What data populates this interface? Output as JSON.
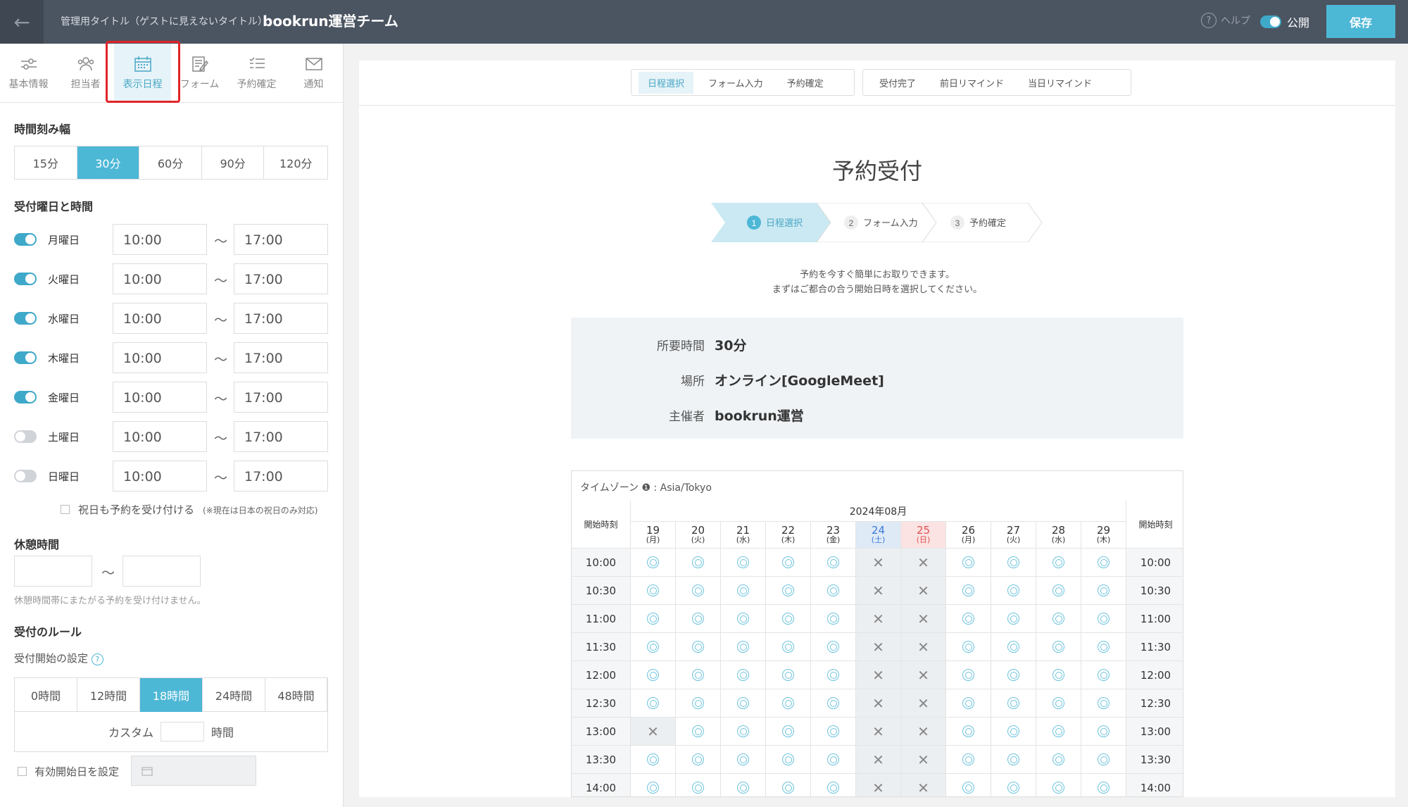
{
  "header": {
    "back_icon": "←",
    "admin_label": "管理用タイトル（ゲストに見えないタイトル）",
    "admin_title": "bookrun運営チーム",
    "help": "ヘルプ",
    "publish": "公開",
    "save": "保存"
  },
  "tabs": [
    "基本情報",
    "担当者",
    "表示日程",
    "フォーム",
    "予約確定",
    "通知"
  ],
  "interval": {
    "label": "時間刻み幅",
    "options": [
      "15分",
      "30分",
      "60分",
      "90分",
      "120分"
    ],
    "selected": "30分"
  },
  "days_section": "受付曜日と時間",
  "days": [
    {
      "label": "月曜日",
      "on": true,
      "from": "10:00",
      "to": "17:00"
    },
    {
      "label": "火曜日",
      "on": true,
      "from": "10:00",
      "to": "17:00"
    },
    {
      "label": "水曜日",
      "on": true,
      "from": "10:00",
      "to": "17:00"
    },
    {
      "label": "木曜日",
      "on": true,
      "from": "10:00",
      "to": "17:00"
    },
    {
      "label": "金曜日",
      "on": true,
      "from": "10:00",
      "to": "17:00"
    },
    {
      "label": "土曜日",
      "on": false,
      "from": "10:00",
      "to": "17:00"
    },
    {
      "label": "日曜日",
      "on": false,
      "from": "10:00",
      "to": "17:00"
    }
  ],
  "tilde": "〜",
  "holiday": {
    "label": "祝日も予約を受け付ける",
    "note": "(※現在は日本の祝日のみ対応)"
  },
  "break": {
    "title": "休憩時間",
    "note": "休憩時間帯にまたがる予約を受け付けません。"
  },
  "rules": {
    "title": "受付のルール",
    "start_label": "受付開始の設定",
    "options": [
      "0時間",
      "12時間",
      "18時間",
      "24時間",
      "48時間"
    ],
    "selected": "18時間",
    "custom": "カスタム",
    "unit": "時間",
    "valid_start": "有効開始日を設定"
  },
  "preview": {
    "nav_left": [
      "日程選択",
      "フォーム入力",
      "予約確定"
    ],
    "nav_right": [
      "受付完了",
      "前日リマインド",
      "当日リマインド"
    ],
    "title": "予約受付",
    "steps": [
      {
        "n": "1",
        "label": "日程選択"
      },
      {
        "n": "2",
        "label": "フォーム入力"
      },
      {
        "n": "3",
        "label": "予約確定"
      }
    ],
    "desc1": "予約を今すぐ簡単にお取りできます。",
    "desc2": "まずはご都合の合う開始日時を選択してください。",
    "info": [
      {
        "label": "所要時間",
        "value": "30分"
      },
      {
        "label": "場所",
        "value": "オンライン[GoogleMeet]"
      },
      {
        "label": "主催者",
        "value": "bookrun運営"
      }
    ],
    "timezone": "タイムゾーン ❶ : Asia/Tokyo",
    "month": "2024年08月",
    "start_col": "開始時刻",
    "dates": [
      {
        "d": "19",
        "w": "(月)"
      },
      {
        "d": "20",
        "w": "(火)"
      },
      {
        "d": "21",
        "w": "(水)"
      },
      {
        "d": "22",
        "w": "(木)"
      },
      {
        "d": "23",
        "w": "(金)"
      },
      {
        "d": "24",
        "w": "(土)",
        "type": "sat"
      },
      {
        "d": "25",
        "w": "(日)",
        "type": "sun"
      },
      {
        "d": "26",
        "w": "(月)"
      },
      {
        "d": "27",
        "w": "(火)"
      },
      {
        "d": "28",
        "w": "(水)"
      },
      {
        "d": "29",
        "w": "(木)"
      }
    ],
    "times": [
      "10:00",
      "10:30",
      "11:00",
      "11:30",
      "12:00",
      "12:30",
      "13:00",
      "13:30",
      "14:00"
    ],
    "unavailable": [
      [
        "13:00",
        "19"
      ]
    ]
  }
}
